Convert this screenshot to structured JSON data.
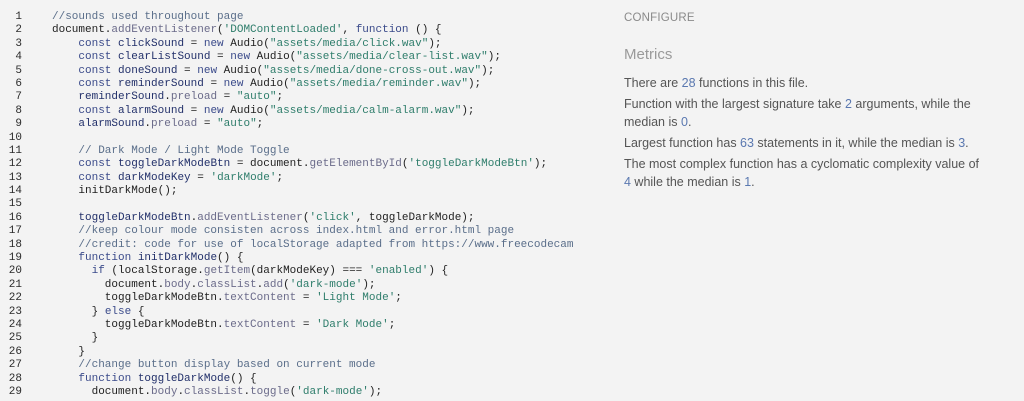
{
  "editor": {
    "lines": [
      [
        [
          "t-com",
          "//sounds used throughout page"
        ]
      ],
      [
        [
          "t-plain",
          "document."
        ],
        [
          "t-prop",
          "addEventListener"
        ],
        [
          "t-plain",
          "("
        ],
        [
          "t-str",
          "'DOMContentLoaded'"
        ],
        [
          "t-plain",
          ", "
        ],
        [
          "t-kw",
          "function"
        ],
        [
          "t-plain",
          " () {"
        ]
      ],
      [
        [
          "t-plain",
          "    "
        ],
        [
          "t-kw",
          "const"
        ],
        [
          "t-plain",
          " "
        ],
        [
          "t-id",
          "clickSound"
        ],
        [
          "t-plain",
          " = "
        ],
        [
          "t-kw",
          "new"
        ],
        [
          "t-plain",
          " Audio("
        ],
        [
          "t-str",
          "\"assets/media/click.wav\""
        ],
        [
          "t-plain",
          ");"
        ]
      ],
      [
        [
          "t-plain",
          "    "
        ],
        [
          "t-kw",
          "const"
        ],
        [
          "t-plain",
          " "
        ],
        [
          "t-id",
          "clearListSound"
        ],
        [
          "t-plain",
          " = "
        ],
        [
          "t-kw",
          "new"
        ],
        [
          "t-plain",
          " Audio("
        ],
        [
          "t-str",
          "\"assets/media/clear-list.wav\""
        ],
        [
          "t-plain",
          ");"
        ]
      ],
      [
        [
          "t-plain",
          "    "
        ],
        [
          "t-kw",
          "const"
        ],
        [
          "t-plain",
          " "
        ],
        [
          "t-id",
          "doneSound"
        ],
        [
          "t-plain",
          " = "
        ],
        [
          "t-kw",
          "new"
        ],
        [
          "t-plain",
          " Audio("
        ],
        [
          "t-str",
          "\"assets/media/done-cross-out.wav\""
        ],
        [
          "t-plain",
          ");"
        ]
      ],
      [
        [
          "t-plain",
          "    "
        ],
        [
          "t-kw",
          "const"
        ],
        [
          "t-plain",
          " "
        ],
        [
          "t-id",
          "reminderSound"
        ],
        [
          "t-plain",
          " = "
        ],
        [
          "t-kw",
          "new"
        ],
        [
          "t-plain",
          " Audio("
        ],
        [
          "t-str",
          "\"assets/media/reminder.wav\""
        ],
        [
          "t-plain",
          ");"
        ]
      ],
      [
        [
          "t-plain",
          "    "
        ],
        [
          "t-id",
          "reminderSound"
        ],
        [
          "t-plain",
          "."
        ],
        [
          "t-prop",
          "preload"
        ],
        [
          "t-plain",
          " = "
        ],
        [
          "t-str",
          "\"auto\""
        ],
        [
          "t-plain",
          ";"
        ]
      ],
      [
        [
          "t-plain",
          "    "
        ],
        [
          "t-kw",
          "const"
        ],
        [
          "t-plain",
          " "
        ],
        [
          "t-id",
          "alarmSound"
        ],
        [
          "t-plain",
          " = "
        ],
        [
          "t-kw",
          "new"
        ],
        [
          "t-plain",
          " Audio("
        ],
        [
          "t-str",
          "\"assets/media/calm-alarm.wav\""
        ],
        [
          "t-plain",
          ");"
        ]
      ],
      [
        [
          "t-plain",
          "    "
        ],
        [
          "t-id",
          "alarmSound"
        ],
        [
          "t-plain",
          "."
        ],
        [
          "t-prop",
          "preload"
        ],
        [
          "t-plain",
          " = "
        ],
        [
          "t-str",
          "\"auto\""
        ],
        [
          "t-plain",
          ";"
        ]
      ],
      [],
      [
        [
          "t-plain",
          "    "
        ],
        [
          "t-com",
          "// Dark Mode / Light Mode Toggle"
        ]
      ],
      [
        [
          "t-plain",
          "    "
        ],
        [
          "t-kw",
          "const"
        ],
        [
          "t-plain",
          " "
        ],
        [
          "t-id",
          "toggleDarkModeBtn"
        ],
        [
          "t-plain",
          " = document."
        ],
        [
          "t-prop",
          "getElementById"
        ],
        [
          "t-plain",
          "("
        ],
        [
          "t-str",
          "'toggleDarkModeBtn'"
        ],
        [
          "t-plain",
          ");"
        ]
      ],
      [
        [
          "t-plain",
          "    "
        ],
        [
          "t-kw",
          "const"
        ],
        [
          "t-plain",
          " "
        ],
        [
          "t-id",
          "darkModeKey"
        ],
        [
          "t-plain",
          " = "
        ],
        [
          "t-str",
          "'darkMode'"
        ],
        [
          "t-plain",
          ";"
        ]
      ],
      [
        [
          "t-plain",
          "    initDarkMode();"
        ]
      ],
      [],
      [
        [
          "t-plain",
          "    "
        ],
        [
          "t-id",
          "toggleDarkModeBtn"
        ],
        [
          "t-plain",
          "."
        ],
        [
          "t-prop",
          "addEventListener"
        ],
        [
          "t-plain",
          "("
        ],
        [
          "t-str",
          "'click'"
        ],
        [
          "t-plain",
          ", toggleDarkMode);"
        ]
      ],
      [
        [
          "t-plain",
          "    "
        ],
        [
          "t-com",
          "//keep colour mode consisten across index.html and error.html page"
        ]
      ],
      [
        [
          "t-plain",
          "    "
        ],
        [
          "t-com",
          "//credit: code for use of localStorage adapted from https://www.freecodecam"
        ]
      ],
      [
        [
          "t-plain",
          "    "
        ],
        [
          "t-kw",
          "function"
        ],
        [
          "t-plain",
          " "
        ],
        [
          "t-id",
          "initDarkMode"
        ],
        [
          "t-plain",
          "() {"
        ]
      ],
      [
        [
          "t-plain",
          "      "
        ],
        [
          "t-kw",
          "if"
        ],
        [
          "t-plain",
          " (localStorage."
        ],
        [
          "t-prop",
          "getItem"
        ],
        [
          "t-plain",
          "(darkModeKey) === "
        ],
        [
          "t-str",
          "'enabled'"
        ],
        [
          "t-plain",
          ") {"
        ]
      ],
      [
        [
          "t-plain",
          "        document."
        ],
        [
          "t-prop",
          "body"
        ],
        [
          "t-plain",
          "."
        ],
        [
          "t-prop",
          "classList"
        ],
        [
          "t-plain",
          "."
        ],
        [
          "t-prop",
          "add"
        ],
        [
          "t-plain",
          "("
        ],
        [
          "t-str",
          "'dark-mode'"
        ],
        [
          "t-plain",
          ");"
        ]
      ],
      [
        [
          "t-plain",
          "        toggleDarkModeBtn."
        ],
        [
          "t-prop",
          "textContent"
        ],
        [
          "t-plain",
          " = "
        ],
        [
          "t-str",
          "'Light Mode'"
        ],
        [
          "t-plain",
          ";"
        ]
      ],
      [
        [
          "t-plain",
          "      } "
        ],
        [
          "t-kw",
          "else"
        ],
        [
          "t-plain",
          " {"
        ]
      ],
      [
        [
          "t-plain",
          "        toggleDarkModeBtn."
        ],
        [
          "t-prop",
          "textContent"
        ],
        [
          "t-plain",
          " = "
        ],
        [
          "t-str",
          "'Dark Mode'"
        ],
        [
          "t-plain",
          ";"
        ]
      ],
      [
        [
          "t-plain",
          "      }"
        ]
      ],
      [
        [
          "t-plain",
          "    }"
        ]
      ],
      [
        [
          "t-plain",
          "    "
        ],
        [
          "t-com",
          "//change button display based on current mode"
        ]
      ],
      [
        [
          "t-plain",
          "    "
        ],
        [
          "t-kw",
          "function"
        ],
        [
          "t-plain",
          " "
        ],
        [
          "t-id",
          "toggleDarkMode"
        ],
        [
          "t-plain",
          "() {"
        ]
      ],
      [
        [
          "t-plain",
          "      document."
        ],
        [
          "t-prop",
          "body"
        ],
        [
          "t-plain",
          "."
        ],
        [
          "t-prop",
          "classList"
        ],
        [
          "t-plain",
          "."
        ],
        [
          "t-prop",
          "toggle"
        ],
        [
          "t-plain",
          "("
        ],
        [
          "t-str",
          "'dark-mode'"
        ],
        [
          "t-plain",
          ");"
        ]
      ]
    ]
  },
  "panel": {
    "configure_label": "CONFIGURE",
    "metrics_title": "Metrics",
    "metrics": [
      [
        [
          "t",
          "There are "
        ],
        [
          "n",
          "28"
        ],
        [
          "t",
          " functions in this file."
        ]
      ],
      [
        [
          "t",
          "Function with the largest signature take "
        ],
        [
          "n",
          "2"
        ],
        [
          "t",
          " arguments, while the median is "
        ],
        [
          "n",
          "0"
        ],
        [
          "t",
          "."
        ]
      ],
      [
        [
          "t",
          "Largest function has "
        ],
        [
          "n",
          "63"
        ],
        [
          "t",
          " statements in it, while the median is "
        ],
        [
          "n",
          "3"
        ],
        [
          "t",
          "."
        ]
      ],
      [
        [
          "t",
          "The most complex function has a cyclomatic complexity value of "
        ],
        [
          "n",
          "4"
        ],
        [
          "t",
          " while the median is "
        ],
        [
          "n",
          "1"
        ],
        [
          "t",
          "."
        ]
      ]
    ]
  }
}
